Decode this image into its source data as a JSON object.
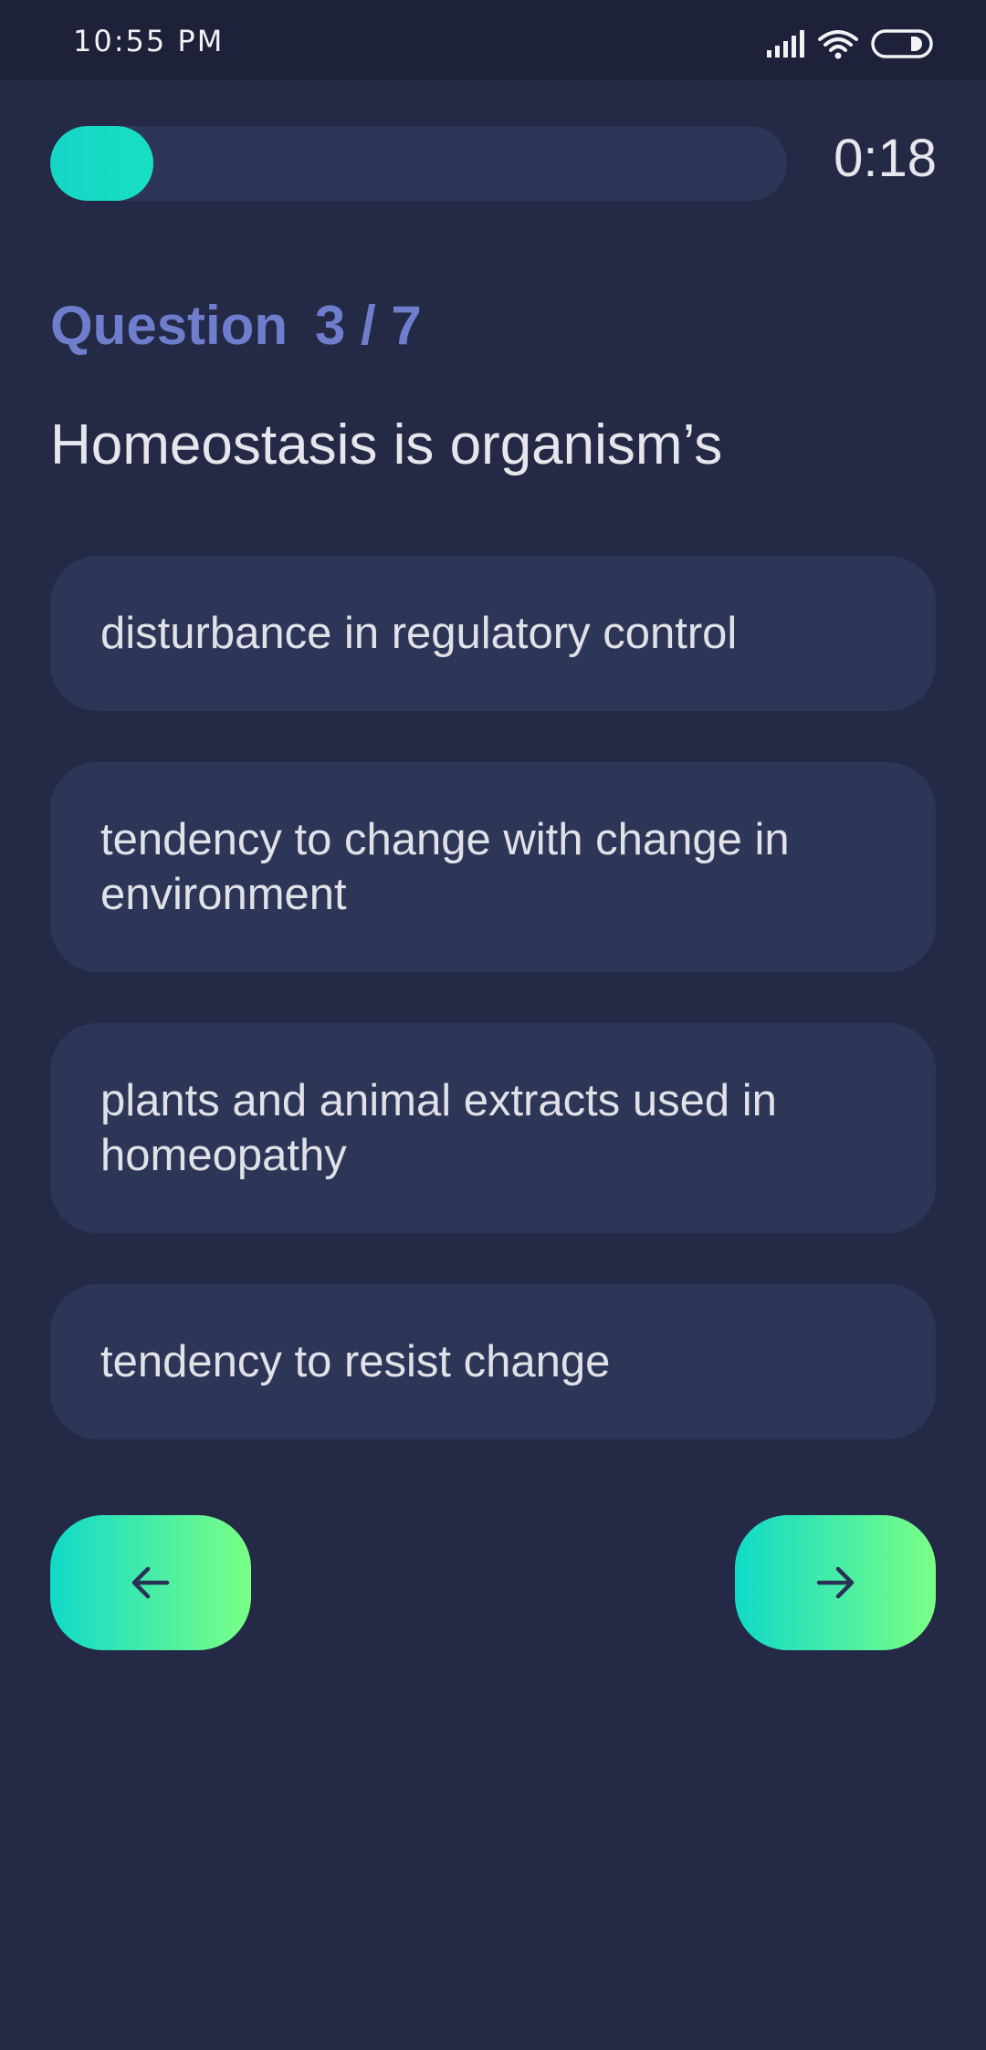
{
  "status_bar": {
    "time": "10:55 PM",
    "icons": [
      "signal-icon",
      "wifi-icon",
      "battery-icon"
    ]
  },
  "progress": {
    "fraction": 0.14,
    "timer": "0:18"
  },
  "question": {
    "label": "Question",
    "counter": "3 / 7",
    "text": "Homeostasis is organism’s"
  },
  "options": [
    {
      "text": "disturbance in regulatory control"
    },
    {
      "text": "tendency to change with change in environment"
    },
    {
      "text": "plants and animal extracts used in homeopathy"
    },
    {
      "text": "tendency to resist change"
    }
  ],
  "navigation": {
    "back_icon": "arrow-left-icon",
    "next_icon": "arrow-right-icon"
  },
  "colors": {
    "background": "#242a46",
    "card": "#2e3658",
    "accent_start": "#10dac9",
    "accent_end": "#7bff85",
    "question_label": "#6e7ecd"
  }
}
